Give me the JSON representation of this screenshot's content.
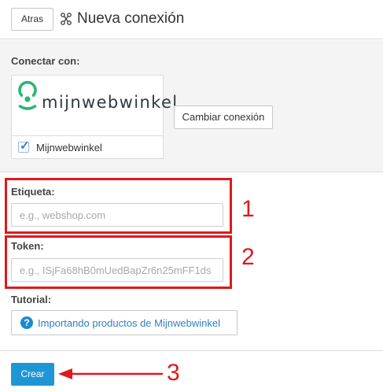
{
  "header": {
    "back_label": "Atras",
    "title": "Nueva conexión"
  },
  "connect": {
    "label": "Conectar con:",
    "provider": {
      "logo_text": "mijnwebwinkel",
      "name": "Mijnwebwinkel",
      "checked": true
    },
    "change_label": "Cambiar conexión"
  },
  "fields": {
    "label_field": {
      "label": "Etiqueta:",
      "value": "",
      "placeholder": "e.g., webshop.com"
    },
    "token_field": {
      "label": "Token:",
      "value": "",
      "placeholder": "e.g., ISjFa68hB0mUedBapZr6n25mFF1ds"
    }
  },
  "tutorial": {
    "label": "Tutorial:",
    "link_text": "Importando productos de Mijnwebwinkel",
    "icon": "question-circle-icon"
  },
  "footer": {
    "create_label": "Crear"
  },
  "annotations": {
    "numbers": [
      "1",
      "2",
      "3"
    ],
    "color": "#e0191c"
  },
  "colors": {
    "accent": "#1e96d6",
    "link": "#2f7fc1",
    "logo_green": "#2bb673"
  }
}
